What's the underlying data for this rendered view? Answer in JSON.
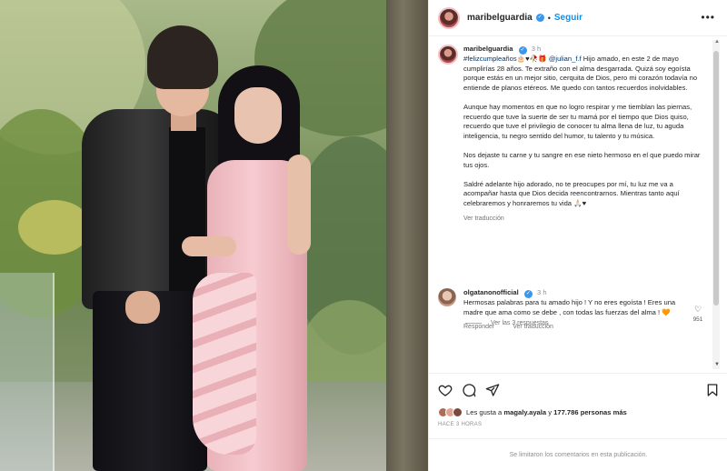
{
  "post": {
    "username": "maribelguardia",
    "follow_label": "Seguir",
    "dot": "•",
    "more_label": "•••"
  },
  "caption": {
    "username": "maribelguardia",
    "time": "3 h",
    "hashtag": "#felizcumpleaños",
    "emojis": "🎂♥🥀🎁",
    "mention": "@julian_f.f",
    "p1_rest": " Hijo amado, en este 2 de mayo cumplirías 28 años. Te extraño con el alma desgarrada. Quizá soy egoísta porque estás en un mejor sitio, cerquita de Dios, pero mi corazón todavía no entiende de planos etéreos. Me quedo con tantos recuerdos inolvidables.",
    "p2": "Aunque hay momentos en que no logro respirar y me tiemblan las piernas, recuerdo que tuve la suerte de ser tu mamá por el tiempo que Dios quiso, recuerdo que tuve el privilegio de conocer tu alma llena de luz, tu aguda inteligencia, tu negro sentido del humor, tu talento y tu música.",
    "p3": "Nos dejaste tu carne y tu sangre en ese nieto hermoso en el que puedo mirar tus ojos.",
    "p4": "Saldré adelante hijo adorado, no te preocupes por mí, tu luz me va a acompañar hasta que Dios decida reencontrarnos. Mientras tanto aquí celebraremos y honraremos tu vida 🙏🏻♥",
    "translate": "Ver traducción"
  },
  "comment": {
    "username": "olgatanonofficial",
    "time": "3 h",
    "text": "Hermosas palabras para tu amado hijo ! Y no eres egoísta ! Eres una madre que ama como se debe , con todas las fuerzas del alma ! 🧡",
    "likes": "951",
    "reply": "Responder",
    "translate": "Ver traducción",
    "view_replies": "Ver las 3 respuestas"
  },
  "actions": {
    "like_icon": "heart-icon",
    "comment_icon": "comment-icon",
    "share_icon": "share-icon",
    "save_icon": "bookmark-icon"
  },
  "likes": {
    "prefix": "Les gusta a ",
    "user": "magaly.ayala",
    "middle": " y ",
    "count": "177.786 personas más"
  },
  "time_ago": "HACE 3 HORAS",
  "footer": "Se limitaron los comentarios en esta publicación.",
  "colors": {
    "accent": "#0095f6",
    "verified": "#3897f0",
    "muted": "#8e8e8e"
  }
}
